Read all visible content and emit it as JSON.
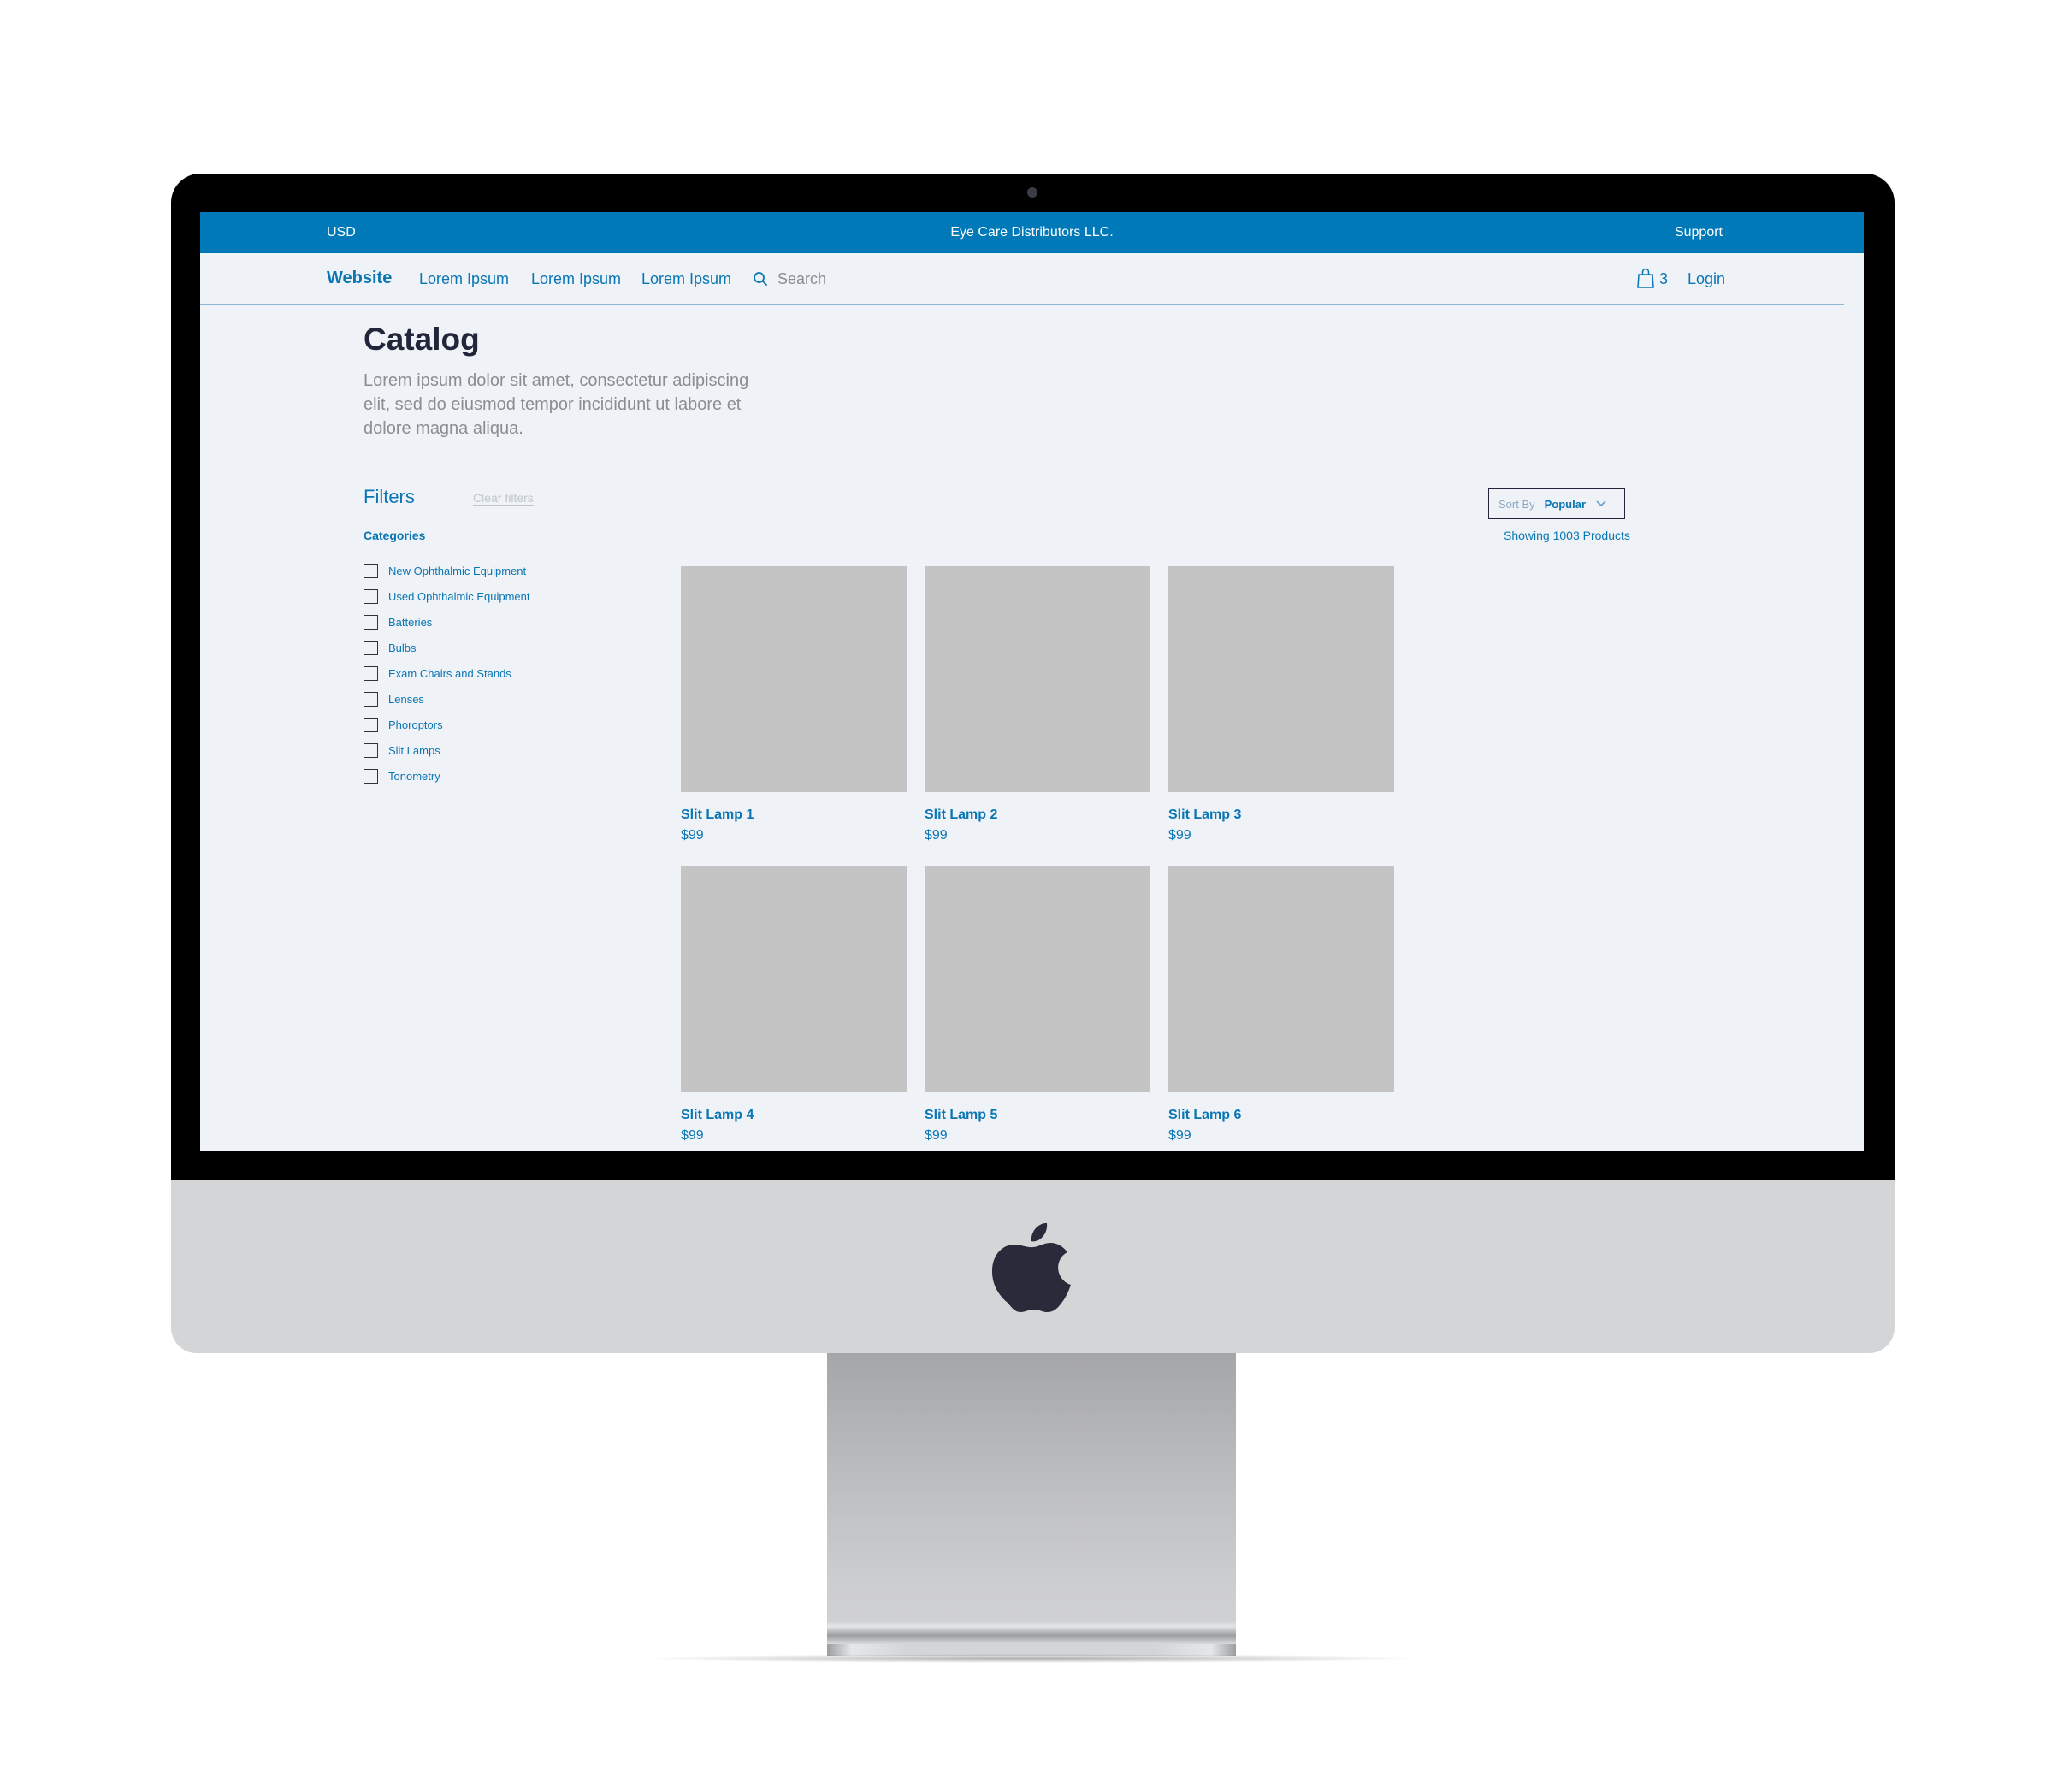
{
  "colors": {
    "brand_blue": "#0079b8",
    "screen_bg": "#eff2f7",
    "placeholder": "#c4c4c4",
    "heading": "#23263a"
  },
  "topbar": {
    "currency": "USD",
    "company": "Eye Care Distributors LLC.",
    "support": "Support"
  },
  "nav": {
    "brand": "Website",
    "links": [
      "Lorem Ipsum",
      "Lorem Ipsum",
      "Lorem Ipsum"
    ],
    "search_placeholder": "Search",
    "search_icon": "search-icon",
    "cart_icon": "shopping-bag-icon",
    "cart_count": "3",
    "login": "Login"
  },
  "page": {
    "title": "Catalog",
    "description": "Lorem ipsum dolor sit amet, consectetur adipiscing elit, sed do eiusmod tempor incididunt ut labore et dolore magna aliqua."
  },
  "filters": {
    "title": "Filters",
    "clear": "Clear filters",
    "categories_label": "Categories",
    "categories": [
      {
        "label": "New Ophthalmic Equipment",
        "checked": false
      },
      {
        "label": "Used Ophthalmic Equipment",
        "checked": false
      },
      {
        "label": "Batteries",
        "checked": false
      },
      {
        "label": "Bulbs",
        "checked": false
      },
      {
        "label": "Exam Chairs and Stands",
        "checked": false
      },
      {
        "label": "Lenses",
        "checked": false
      },
      {
        "label": "Phoroptors",
        "checked": false
      },
      {
        "label": "Slit Lamps",
        "checked": false
      },
      {
        "label": "Tonometry",
        "checked": false
      }
    ]
  },
  "sort": {
    "label": "Sort By",
    "value": "Popular",
    "showing": "Showing 1003 Products"
  },
  "products": [
    {
      "name": "Slit Lamp 1",
      "price": "$99"
    },
    {
      "name": "Slit Lamp 2",
      "price": "$99"
    },
    {
      "name": "Slit Lamp 3",
      "price": "$99"
    },
    {
      "name": "Slit Lamp 4",
      "price": "$99"
    },
    {
      "name": "Slit Lamp 5",
      "price": "$99"
    },
    {
      "name": "Slit Lamp 6",
      "price": "$99"
    }
  ]
}
